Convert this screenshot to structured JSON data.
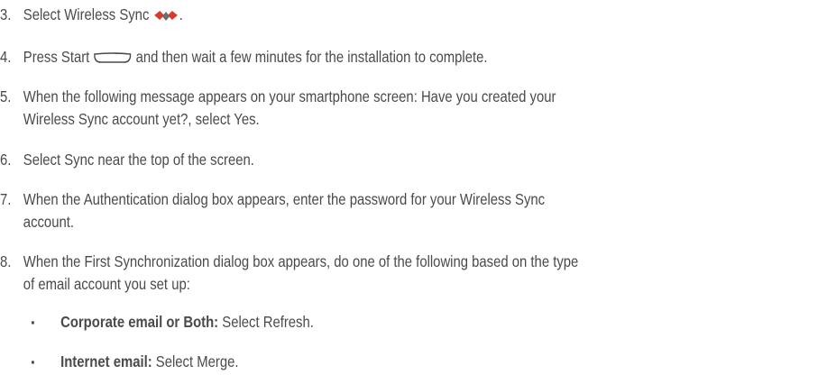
{
  "steps": [
    {
      "number": "3.",
      "text_before": "Select Wireless Sync",
      "icon": "wireless-sync-icon",
      "text_after": "."
    },
    {
      "number": "4.",
      "text_before": "Press Start",
      "icon": "start-key-icon",
      "text_after": "and then wait a few minutes for the installation to complete."
    },
    {
      "number": "5.",
      "line1": "When the following message appears on your smartphone screen: Have you created your",
      "line2": "Wireless Sync account yet?, select Yes."
    },
    {
      "number": "6.",
      "text": "Select Sync near the top of the screen."
    },
    {
      "number": "7.",
      "line1": "When the Authentication dialog box appears, enter the password for your Wireless Sync",
      "line2": "account."
    },
    {
      "number": "8.",
      "line1": "When the First Synchronization dialog box appears, do one of the following based on the type",
      "line2": "of email account you set up:"
    }
  ],
  "bullets": [
    {
      "mark": "▪",
      "label": "Corporate email or Both:",
      "text": "Select Refresh."
    },
    {
      "mark": "▪",
      "label": "Internet email:",
      "text": "Select Merge."
    }
  ],
  "colors": {
    "text": "#4a4a4a",
    "icon_red": "#d83a2b",
    "icon_gray": "#6d6d6d"
  }
}
